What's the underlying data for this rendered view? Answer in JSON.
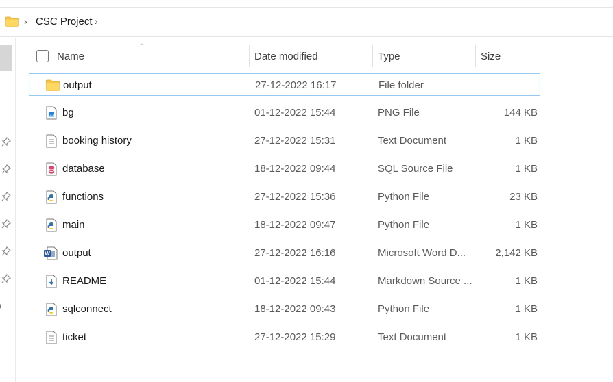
{
  "breadcrumb": {
    "folder": "CSC Project"
  },
  "columns": {
    "name": "Name",
    "date": "Date modified",
    "type": "Type",
    "size": "Size"
  },
  "files": [
    {
      "name": "output",
      "date": "27-12-2022 16:17",
      "type": "File folder",
      "size": "",
      "icon": "folder-icon",
      "selected": true
    },
    {
      "name": "bg",
      "date": "01-12-2022 15:44",
      "type": "PNG File",
      "size": "144 KB",
      "icon": "image-file-icon"
    },
    {
      "name": "booking history",
      "date": "27-12-2022 15:31",
      "type": "Text Document",
      "size": "1 KB",
      "icon": "text-file-icon"
    },
    {
      "name": "database",
      "date": "18-12-2022 09:44",
      "type": "SQL Source File",
      "size": "1 KB",
      "icon": "sql-file-icon"
    },
    {
      "name": "functions",
      "date": "27-12-2022 15:36",
      "type": "Python File",
      "size": "23 KB",
      "icon": "python-file-icon"
    },
    {
      "name": "main",
      "date": "18-12-2022 09:47",
      "type": "Python File",
      "size": "1 KB",
      "icon": "python-file-icon"
    },
    {
      "name": "output",
      "date": "27-12-2022 16:16",
      "type": "Microsoft Word D...",
      "size": "2,142 KB",
      "icon": "word-file-icon"
    },
    {
      "name": "README",
      "date": "01-12-2022 15:44",
      "type": "Markdown Source ...",
      "size": "1 KB",
      "icon": "markdown-file-icon"
    },
    {
      "name": "sqlconnect",
      "date": "18-12-2022 09:43",
      "type": "Python File",
      "size": "1 KB",
      "icon": "python-file-icon"
    },
    {
      "name": "ticket",
      "date": "27-12-2022 15:29",
      "type": "Text Document",
      "size": "1 KB",
      "icon": "text-file-icon"
    }
  ],
  "colors": {
    "selection_border": "#99c9ef",
    "folder": "#f6c744"
  }
}
